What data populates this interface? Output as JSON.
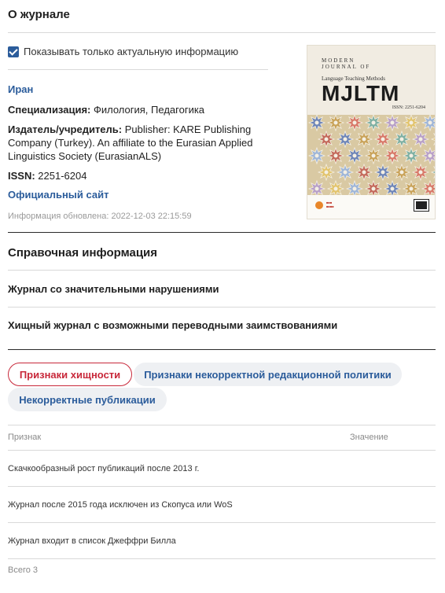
{
  "about": {
    "title": "О журнале",
    "checkbox_label": "Показывать только актуальную информацию",
    "checkbox_checked": true,
    "country": "Иран",
    "specialization_label": "Специализация:",
    "specialization_value": "Филология, Педагогика",
    "publisher_label": "Издатель/учредитель:",
    "publisher_value": "Publisher: KARE Publishing Company (Turkey). An affiliate to the Eurasian Applied Linguistics Society (EurasianALS)",
    "issn_label": "ISSN:",
    "issn_value": "2251-6204",
    "official_site": "Официальный сайт",
    "updated": "Информация обновлена: 2022-12-03 22:15:59"
  },
  "cover": {
    "line1": "MODERN",
    "line2": "JOURNAL OF",
    "line3": "Language Teaching Methods",
    "title": "MJLTM",
    "issn": "ISSN: 2251-6204"
  },
  "reference": {
    "title": "Справочная информация",
    "item1": "Журнал со значительными нарушениями",
    "item2": "Хищный журнал с возможными переводными заимствованиями"
  },
  "tabs": [
    {
      "label": "Признаки хищности",
      "active": true
    },
    {
      "label": "Признаки некорректной редакционной политики",
      "active": false
    },
    {
      "label": "Некорректные публикации",
      "active": false
    }
  ],
  "table": {
    "col_sign": "Признак",
    "col_value": "Значение",
    "rows": [
      {
        "sign": "Скачкообразный рост публикаций после 2013 г.",
        "value": ""
      },
      {
        "sign": "Журнал после 2015 года исключен из Скопуса или WoS",
        "value": ""
      },
      {
        "sign": "Журнал входит в список Джеффри Билла",
        "value": ""
      }
    ],
    "total": "Всего 3"
  },
  "colors": {
    "link": "#2b5c9b",
    "accent_red": "#c8283a",
    "checkbox": "#2b5c9b"
  }
}
